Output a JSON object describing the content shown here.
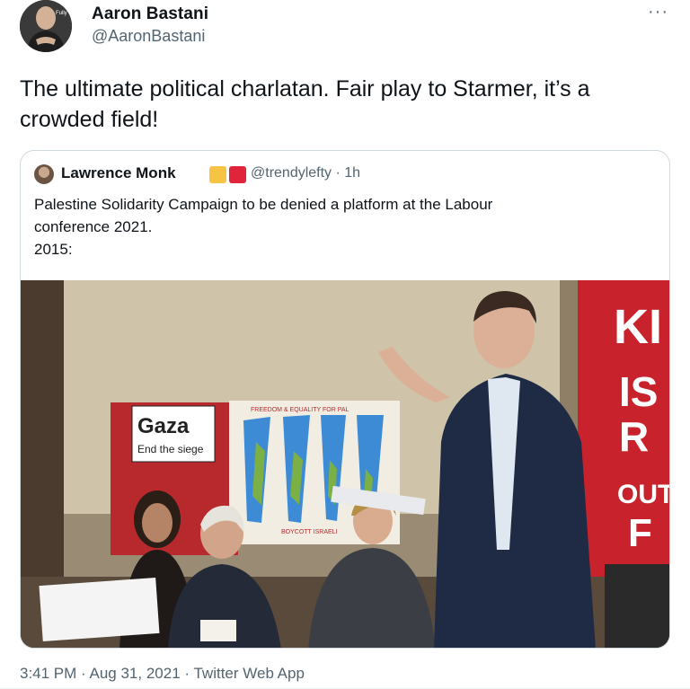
{
  "author": {
    "name": "Aaron Bastani",
    "handle": "@AaronBastani",
    "avatar_badge": "Fully"
  },
  "tweet": {
    "text": "The ultimate political charlatan. Fair play to Starmer, it’s a crowded field!",
    "time": "3:41 PM",
    "date": "Aug 31, 2021",
    "source": "Twitter Web App"
  },
  "quoted": {
    "name": "Lawrence Monk",
    "flag_colors": [
      "#f6c344",
      "#e0243a"
    ],
    "handle_time": "@trendylefty · 1h",
    "text_line1": "Palestine Solidarity Campaign to be denied a platform at the Labour",
    "text_line2": "conference 2021.",
    "text_line3": "2015:"
  },
  "photo": {
    "sign_gaza_word": "Gaza",
    "sign_gaza_sub": "End the siege",
    "poster_top": "FREEDOM & EQUALITY FOR PAL",
    "poster_bottom": "BOYCOTT ISRAELI",
    "banner_lines": [
      "KI",
      "IS",
      "R",
      "OUT",
      "F"
    ]
  },
  "colors": {
    "text_primary": "#0f1419",
    "text_secondary": "#536471",
    "border": "#cfd9de",
    "banner_red": "#c8232c"
  },
  "icons": {
    "more": "more-horizontal-icon"
  }
}
